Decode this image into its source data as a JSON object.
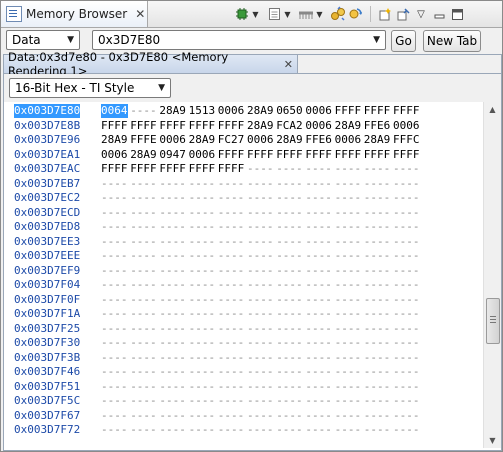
{
  "view": {
    "title": "Memory Browser",
    "close_glyph": "✕",
    "toolbar_icons": [
      "chip-icon",
      "page-icon",
      "comb-icon",
      "connect-icon",
      "refresh-icon",
      "new-view-icon",
      "pin-icon",
      "view-menu-icon",
      "minimize-icon",
      "maximize-icon"
    ]
  },
  "address_bar": {
    "memory_space": "Data",
    "address": "0x3D7E80",
    "go_label": "Go",
    "new_tab_label": "New Tab"
  },
  "rendering": {
    "tab_label": "Data:0x3d7e80 - 0x3D7E80 <Memory Rendering 1>",
    "format": "16-Bit Hex - TI Style"
  },
  "memory": {
    "rows": [
      {
        "address": "0x003D7E80",
        "cells": [
          "0064",
          "----",
          "28A9",
          "1513",
          "0006",
          "28A9",
          "0650",
          "0006",
          "FFFF",
          "FFFF",
          "FFFF"
        ]
      },
      {
        "address": "0x003D7E8B",
        "cells": [
          "FFFF",
          "FFFF",
          "FFFF",
          "FFFF",
          "FFFF",
          "28A9",
          "FCA2",
          "0006",
          "28A9",
          "FFE6",
          "0006"
        ]
      },
      {
        "address": "0x003D7E96",
        "cells": [
          "28A9",
          "FFFE",
          "0006",
          "28A9",
          "FC27",
          "0006",
          "28A9",
          "FFE6",
          "0006",
          "28A9",
          "FFFC"
        ]
      },
      {
        "address": "0x003D7EA1",
        "cells": [
          "0006",
          "28A9",
          "0947",
          "0006",
          "FFFF",
          "FFFF",
          "FFFF",
          "FFFF",
          "FFFF",
          "FFFF",
          "FFFF"
        ]
      },
      {
        "address": "0x003D7EAC",
        "cells": [
          "FFFF",
          "FFFF",
          "FFFF",
          "FFFF",
          "FFFF",
          "----",
          "----",
          "----",
          "----",
          "----",
          "----"
        ]
      },
      {
        "address": "0x003D7EB7",
        "cells": [
          "----",
          "----",
          "----",
          "----",
          "----",
          "----",
          "----",
          "----",
          "----",
          "----",
          "----"
        ]
      },
      {
        "address": "0x003D7EC2",
        "cells": [
          "----",
          "----",
          "----",
          "----",
          "----",
          "----",
          "----",
          "----",
          "----",
          "----",
          "----"
        ]
      },
      {
        "address": "0x003D7ECD",
        "cells": [
          "----",
          "----",
          "----",
          "----",
          "----",
          "----",
          "----",
          "----",
          "----",
          "----",
          "----"
        ]
      },
      {
        "address": "0x003D7ED8",
        "cells": [
          "----",
          "----",
          "----",
          "----",
          "----",
          "----",
          "----",
          "----",
          "----",
          "----",
          "----"
        ]
      },
      {
        "address": "0x003D7EE3",
        "cells": [
          "----",
          "----",
          "----",
          "----",
          "----",
          "----",
          "----",
          "----",
          "----",
          "----",
          "----"
        ]
      },
      {
        "address": "0x003D7EEE",
        "cells": [
          "----",
          "----",
          "----",
          "----",
          "----",
          "----",
          "----",
          "----",
          "----",
          "----",
          "----"
        ]
      },
      {
        "address": "0x003D7EF9",
        "cells": [
          "----",
          "----",
          "----",
          "----",
          "----",
          "----",
          "----",
          "----",
          "----",
          "----",
          "----"
        ]
      },
      {
        "address": "0x003D7F04",
        "cells": [
          "----",
          "----",
          "----",
          "----",
          "----",
          "----",
          "----",
          "----",
          "----",
          "----",
          "----"
        ]
      },
      {
        "address": "0x003D7F0F",
        "cells": [
          "----",
          "----",
          "----",
          "----",
          "----",
          "----",
          "----",
          "----",
          "----",
          "----",
          "----"
        ]
      },
      {
        "address": "0x003D7F1A",
        "cells": [
          "----",
          "----",
          "----",
          "----",
          "----",
          "----",
          "----",
          "----",
          "----",
          "----",
          "----"
        ]
      },
      {
        "address": "0x003D7F25",
        "cells": [
          "----",
          "----",
          "----",
          "----",
          "----",
          "----",
          "----",
          "----",
          "----",
          "----",
          "----"
        ]
      },
      {
        "address": "0x003D7F30",
        "cells": [
          "----",
          "----",
          "----",
          "----",
          "----",
          "----",
          "----",
          "----",
          "----",
          "----",
          "----"
        ]
      },
      {
        "address": "0x003D7F3B",
        "cells": [
          "----",
          "----",
          "----",
          "----",
          "----",
          "----",
          "----",
          "----",
          "----",
          "----",
          "----"
        ]
      },
      {
        "address": "0x003D7F46",
        "cells": [
          "----",
          "----",
          "----",
          "----",
          "----",
          "----",
          "----",
          "----",
          "----",
          "----",
          "----"
        ]
      },
      {
        "address": "0x003D7F51",
        "cells": [
          "----",
          "----",
          "----",
          "----",
          "----",
          "----",
          "----",
          "----",
          "----",
          "----",
          "----"
        ]
      },
      {
        "address": "0x003D7F5C",
        "cells": [
          "----",
          "----",
          "----",
          "----",
          "----",
          "----",
          "----",
          "----",
          "----",
          "----",
          "----"
        ]
      },
      {
        "address": "0x003D7F67",
        "cells": [
          "----",
          "----",
          "----",
          "----",
          "----",
          "----",
          "----",
          "----",
          "----",
          "----",
          "----"
        ]
      },
      {
        "address": "0x003D7F72",
        "cells": [
          "----",
          "----",
          "----",
          "----",
          "----",
          "----",
          "----",
          "----",
          "----",
          "----",
          "----"
        ]
      }
    ]
  },
  "colors": {
    "selection": "#3399ff",
    "address_text": "#1d4aa8",
    "placeholder_text": "#8a8a8a"
  }
}
